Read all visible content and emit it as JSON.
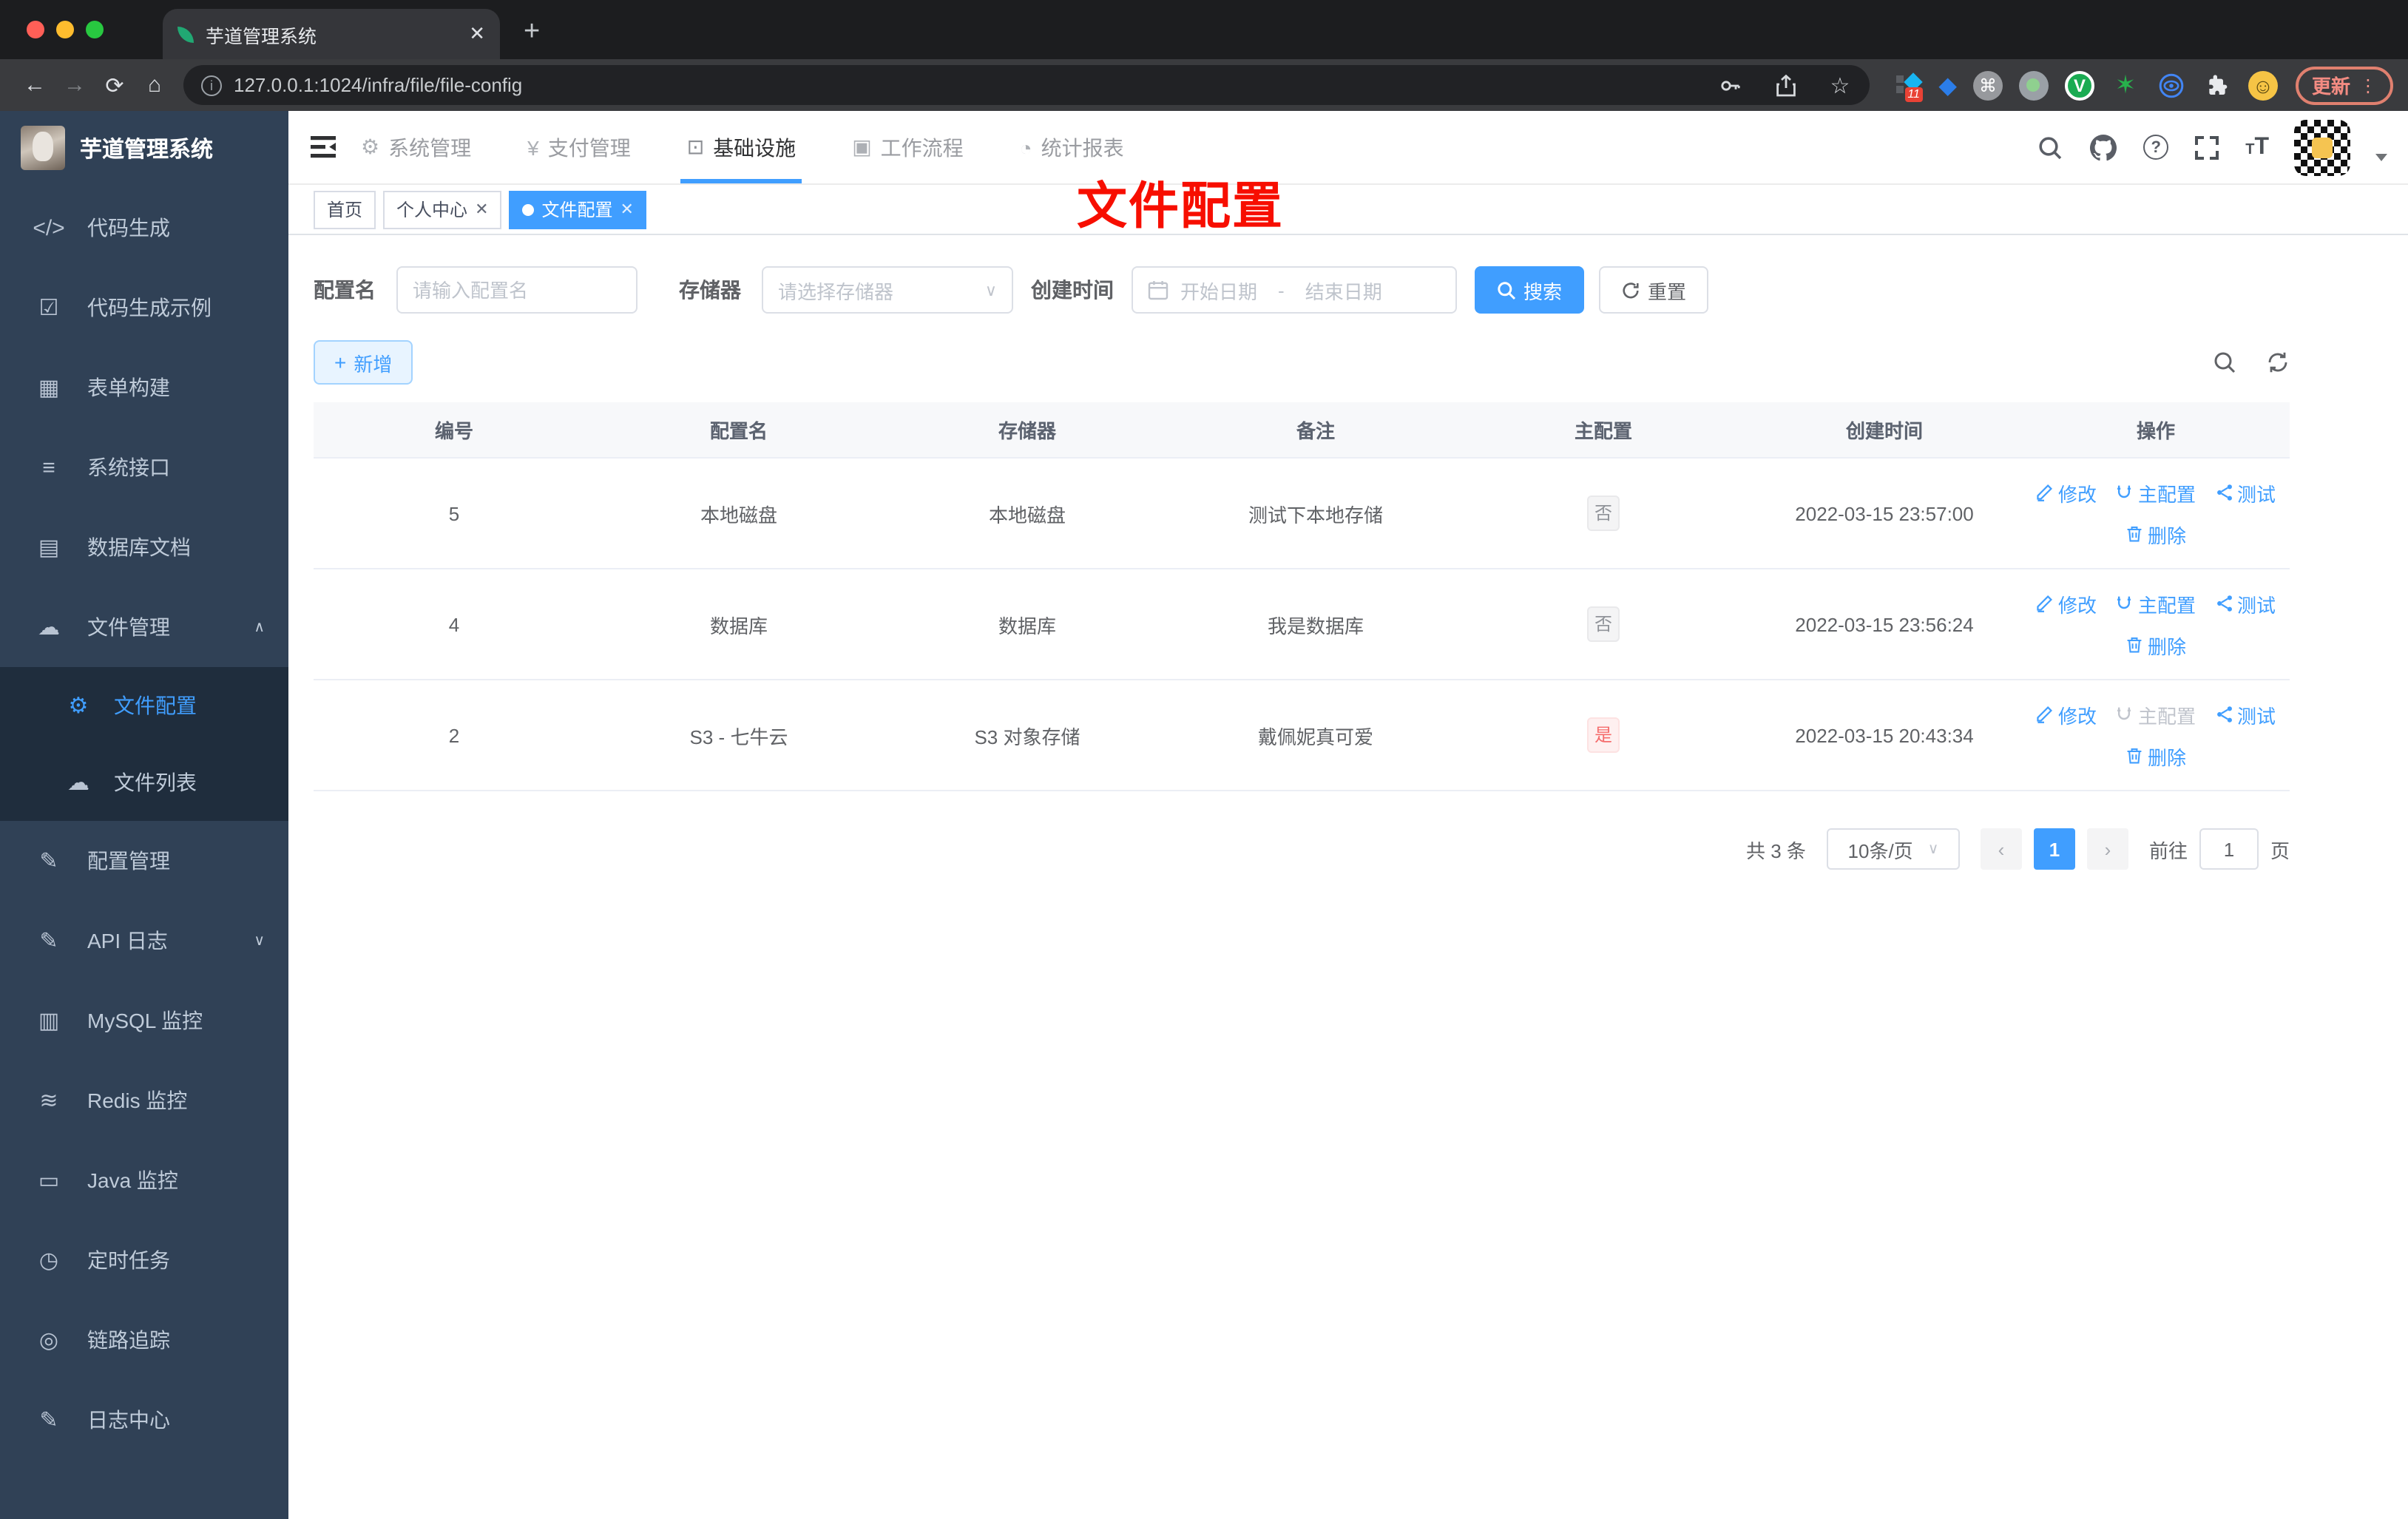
{
  "browser": {
    "tab_title": "芋道管理系统",
    "url": "127.0.0.1:1024/infra/file/file-config",
    "new_tab": "+",
    "extension_badge": "11",
    "update_label": "更新"
  },
  "sidebar": {
    "title": "芋道管理系统",
    "menu": [
      {
        "label": "代码生成",
        "icon": "code-icon"
      },
      {
        "label": "代码生成示例",
        "icon": "shield-check-icon"
      },
      {
        "label": "表单构建",
        "icon": "form-grid-icon"
      },
      {
        "label": "系统接口",
        "icon": "sliders-icon"
      },
      {
        "label": "数据库文档",
        "icon": "table-icon"
      },
      {
        "label": "文件管理",
        "icon": "cloud-download-icon",
        "expanded": true,
        "children": [
          {
            "label": "文件配置",
            "icon": "gear-icon",
            "active": true
          },
          {
            "label": "文件列表",
            "icon": "cloud-upload-icon"
          }
        ]
      },
      {
        "label": "配置管理",
        "icon": "edit-square-icon"
      },
      {
        "label": "API 日志",
        "icon": "document-edit-icon",
        "collapsible": true
      },
      {
        "label": "MySQL 监控",
        "icon": "chart-monitor-icon"
      },
      {
        "label": "Redis 监控",
        "icon": "layers-icon"
      },
      {
        "label": "Java 监控",
        "icon": "monitor-icon"
      },
      {
        "label": "定时任务",
        "icon": "timer-icon"
      },
      {
        "label": "链路追踪",
        "icon": "eye-icon"
      },
      {
        "label": "日志中心",
        "icon": "log-edit-icon"
      }
    ]
  },
  "header": {
    "nav": [
      {
        "label": "系统管理",
        "icon": "gear-icon"
      },
      {
        "label": "支付管理",
        "icon": "yen-icon"
      },
      {
        "label": "基础设施",
        "icon": "infra-monitor-icon",
        "active": true
      },
      {
        "label": "工作流程",
        "icon": "briefcase-icon"
      },
      {
        "label": "统计报表",
        "icon": "dashboard-icon"
      }
    ]
  },
  "tags": [
    {
      "label": "首页"
    },
    {
      "label": "个人中心",
      "closable": true
    },
    {
      "label": "文件配置",
      "active": true,
      "closable": true
    }
  ],
  "annotation": "文件配置",
  "filters": {
    "name_label": "配置名",
    "name_placeholder": "请输入配置名",
    "storage_label": "存储器",
    "storage_placeholder": "请选择存储器",
    "date_label": "创建时间",
    "date_start_placeholder": "开始日期",
    "date_separator": "-",
    "date_end_placeholder": "结束日期",
    "search_label": "搜索",
    "reset_label": "重置"
  },
  "toolbar": {
    "add_label": "新增"
  },
  "table": {
    "headers": [
      "编号",
      "配置名",
      "存储器",
      "备注",
      "主配置",
      "创建时间",
      "操作"
    ],
    "actions": {
      "edit": "修改",
      "master": "主配置",
      "test": "测试",
      "delete": "删除"
    },
    "rows": [
      {
        "id": "5",
        "name": "本地磁盘",
        "storage": "本地磁盘",
        "remark": "测试下本地存储",
        "master": "否",
        "master_type": "info",
        "created": "2022-03-15 23:57:00",
        "master_action_disabled": false
      },
      {
        "id": "4",
        "name": "数据库",
        "storage": "数据库",
        "remark": "我是数据库",
        "master": "否",
        "master_type": "info",
        "created": "2022-03-15 23:56:24",
        "master_action_disabled": false
      },
      {
        "id": "2",
        "name": "S3 - 七牛云",
        "storage": "S3 对象存储",
        "remark": "戴佩妮真可爱",
        "master": "是",
        "master_type": "danger",
        "created": "2022-03-15 20:43:34",
        "master_action_disabled": true
      }
    ]
  },
  "pagination": {
    "total": "共 3 条",
    "page_size": "10条/页",
    "current_page": "1",
    "goto_label": "前往",
    "goto_value": "1",
    "page_unit": "页"
  },
  "colors": {
    "accent": "#409eff",
    "danger": "#f56c6c",
    "sidebar_bg": "#304156",
    "submenu_bg": "#1f2d3d",
    "annotation_red": "#f70e00"
  }
}
